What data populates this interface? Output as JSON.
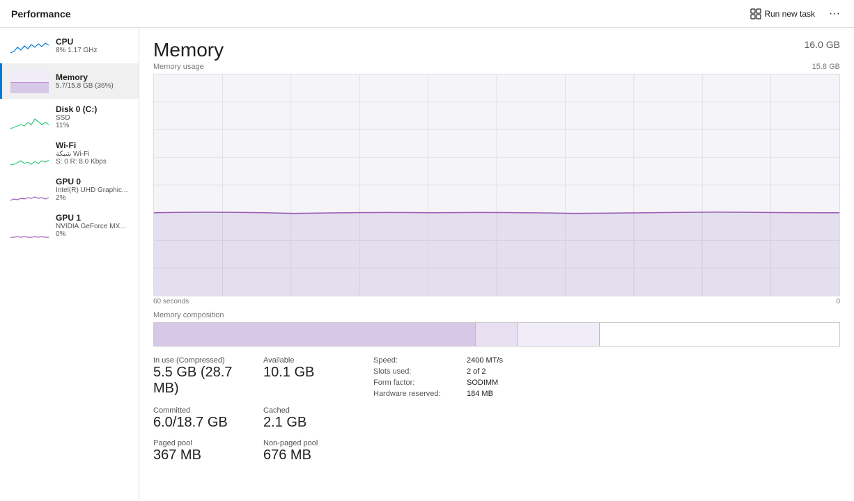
{
  "header": {
    "title": "Performance",
    "run_task_label": "Run new task",
    "more_icon": "···"
  },
  "sidebar": {
    "items": [
      {
        "id": "cpu",
        "name": "CPU",
        "sub1": "8%  1.17 GHz",
        "sub2": "",
        "active": false
      },
      {
        "id": "memory",
        "name": "Memory",
        "sub1": "5.7/15.8 GB (36%)",
        "sub2": "",
        "active": true
      },
      {
        "id": "disk0",
        "name": "Disk 0 (C:)",
        "sub1": "SSD",
        "sub2": "11%",
        "active": false
      },
      {
        "id": "wifi",
        "name": "Wi-Fi",
        "sub1": "شبكة Wi-Fi",
        "sub2": "S: 0  R: 8.0 Kbps",
        "active": false
      },
      {
        "id": "gpu0",
        "name": "GPU 0",
        "sub1": "Intel(R) UHD Graphic...",
        "sub2": "2%",
        "active": false
      },
      {
        "id": "gpu1",
        "name": "GPU 1",
        "sub1": "NVIDIA GeForce MX...",
        "sub2": "0%",
        "active": false
      }
    ]
  },
  "main": {
    "title": "Memory",
    "total": "16.0 GB",
    "max_label": "15.8 GB",
    "chart_label": "Memory usage",
    "chart_bottom_left": "60 seconds",
    "chart_bottom_right": "0",
    "composition_label": "Memory composition",
    "stats": {
      "inuse_label": "In use (Compressed)",
      "inuse_value": "5.5 GB (28.7 MB)",
      "available_label": "Available",
      "available_value": "10.1 GB",
      "committed_label": "Committed",
      "committed_value": "6.0/18.7 GB",
      "cached_label": "Cached",
      "cached_value": "2.1 GB",
      "paged_pool_label": "Paged pool",
      "paged_pool_value": "367 MB",
      "non_paged_pool_label": "Non-paged pool",
      "non_paged_pool_value": "676 MB",
      "speed_label": "Speed:",
      "speed_value": "2400 MT/s",
      "slots_label": "Slots used:",
      "slots_value": "2 of 2",
      "form_factor_label": "Form factor:",
      "form_factor_value": "SODIMM",
      "hw_reserved_label": "Hardware reserved:",
      "hw_reserved_value": "184 MB"
    }
  }
}
